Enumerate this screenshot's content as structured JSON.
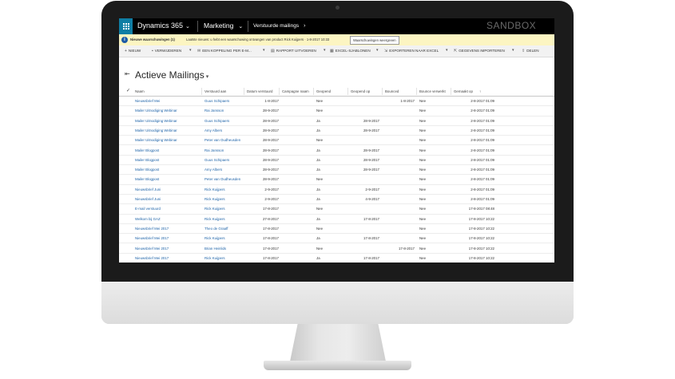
{
  "topbar": {
    "app": "Dynamics 365",
    "area": "Marketing",
    "entity": "Verstuurde mailings",
    "environment": "SANDBOX"
  },
  "notification": {
    "title": "Nieuwe waarschuwingen (1)",
    "message": "Laatste nieuws: u hebt een waarschuwing ontvangen van product Rick Kuijpers · 1-8-2017 10:33",
    "button": "Waarschuwingen weergeven"
  },
  "commandbar": {
    "new": "NIEUW",
    "delete": "VERWIJDEREN",
    "email_link": "EEN KOPPELING PER E-M...",
    "run_report": "RAPPORT UITVOEREN",
    "excel_templates": "EXCEL-SJABLONEN",
    "export_excel": "EXPORTEREN NAAR EXCEL",
    "import_data": "GEGEVENS IMPORTEREN",
    "share": "DELEN"
  },
  "view": {
    "title": "Actieve Mailings"
  },
  "columns": [
    "Naam",
    "Verstuurd aan",
    "Datum verstuurd",
    "Campagne naam",
    "Geopend",
    "Geopend op",
    "Bounced",
    "Bounce verwerkt",
    "Gemaakt op"
  ],
  "rows": [
    [
      "Nieuwsbrief Mei",
      "Guus Schipaers",
      "1-8-2017",
      "",
      "Nee",
      "",
      "1-8-2017",
      "Nee",
      "2-8-2017 01:09"
    ],
    [
      "Mailer Uitnodiging Webinar",
      "Rai Jansson",
      "28-9-2017",
      "",
      "Nee",
      "",
      "",
      "Nee",
      "2-8-2017 01:09"
    ],
    [
      "Mailer Uitnodiging Webinar",
      "Guus Schipaers",
      "28-9-2017",
      "",
      "Ja",
      "28-9-2017",
      "",
      "Nee",
      "2-8-2017 01:09"
    ],
    [
      "Mailer Uitnodiging Webinar",
      "Amy Albers",
      "28-9-2017",
      "",
      "Ja",
      "28-9-2017",
      "",
      "Nee",
      "2-8-2017 01:09"
    ],
    [
      "Mailer Uitnodiging Webinar",
      "Peter van Oudheusden",
      "28-9-2017",
      "",
      "Nee",
      "",
      "",
      "Nee",
      "2-8-2017 01:09"
    ],
    [
      "Mailer Blogpost",
      "Rai Jansson",
      "28-9-2017",
      "",
      "Ja",
      "28-9-2017",
      "",
      "Nee",
      "2-8-2017 01:09"
    ],
    [
      "Mailer Blogpost",
      "Guus Schipaers",
      "28-9-2017",
      "",
      "Ja",
      "28-9-2017",
      "",
      "Nee",
      "2-8-2017 01:09"
    ],
    [
      "Mailer Blogpost",
      "Amy Albers",
      "28-9-2017",
      "",
      "Ja",
      "28-9-2017",
      "",
      "Nee",
      "2-8-2017 01:09"
    ],
    [
      "Mailer Blogpost",
      "Peter van Oudheusden",
      "28-9-2017",
      "",
      "Nee",
      "",
      "",
      "Nee",
      "2-8-2017 01:09"
    ],
    [
      "Nieuwsbrief Juni",
      "Rick Kuijpers",
      "2-9-2017",
      "",
      "Ja",
      "2-9-2017",
      "",
      "Nee",
      "2-8-2017 01:09"
    ],
    [
      "Nieuwsbrief Juni",
      "Rick Kuijpers",
      "2-9-2017",
      "",
      "Ja",
      "4-9-2017",
      "",
      "Nee",
      "2-8-2017 01:09"
    ],
    [
      "E-mail verstuurd",
      "Rick Kuijpers",
      "17-8-2017",
      "",
      "Nee",
      "",
      "",
      "Nee",
      "17-8-2017 08:48"
    ],
    [
      "Welkom bij GAZ",
      "Rick Kuijpers",
      "27-8-2017",
      "",
      "Ja",
      "17-8-2017",
      "",
      "Nee",
      "17-8-2017 10:22"
    ],
    [
      "Nieuwsbrief Mei 2017",
      "Theo de Graaff",
      "17-8-2017",
      "",
      "Nee",
      "",
      "",
      "Nee",
      "17-8-2017 10:22"
    ],
    [
      "Nieuwsbrief Mei 2017",
      "Rick Kuijpers",
      "17-8-2017",
      "",
      "Ja",
      "17-8-2017",
      "",
      "Nee",
      "17-8-2017 10:22"
    ],
    [
      "Nieuwsbrief Mei 2017",
      "Brian Heinlids",
      "17-8-2017",
      "",
      "Nee",
      "",
      "17-8-2017",
      "Nee",
      "17-8-2017 10:22"
    ],
    [
      "Nieuwsbrief Mei 2017",
      "Rick Kuijpers",
      "17-8-2017",
      "",
      "Ja",
      "17-8-2017",
      "",
      "Nee",
      "17-8-2017 10:22"
    ]
  ]
}
